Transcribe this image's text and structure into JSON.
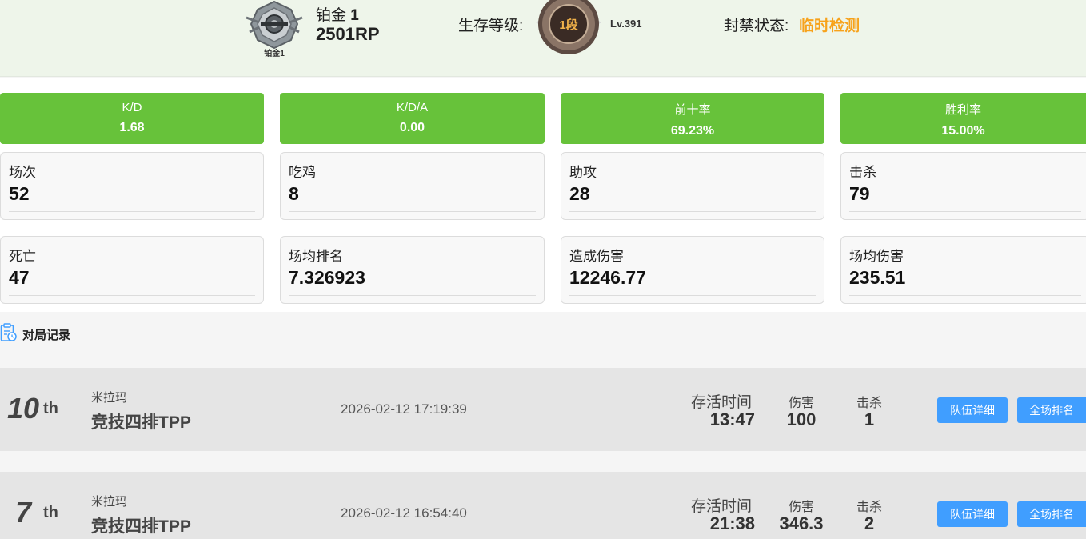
{
  "header": {
    "rank_emblem_label": "铂金1",
    "rank_tier": "铂金",
    "rank_division": "1",
    "rank_points": "2501RP",
    "survival_label": "生存等级:",
    "survival_badge": "1段",
    "survival_level": "Lv.391",
    "ban_label": "封禁状态:",
    "ban_value": "临时检测"
  },
  "ratios": [
    {
      "label": "K/D",
      "value": "1.68"
    },
    {
      "label": "K/D/A",
      "value": "0.00"
    },
    {
      "label": "前十率",
      "value": "69.23%"
    },
    {
      "label": "胜利率",
      "value": "15.00%"
    }
  ],
  "stats": [
    {
      "label": "场次",
      "value": "52"
    },
    {
      "label": "吃鸡",
      "value": "8"
    },
    {
      "label": "助攻",
      "value": "28"
    },
    {
      "label": "击杀",
      "value": "79"
    },
    {
      "label": "死亡",
      "value": "47"
    },
    {
      "label": "场均排名",
      "value": "7.326923"
    },
    {
      "label": "造成伤害",
      "value": "12246.77"
    },
    {
      "label": "场均伤害",
      "value": "235.51"
    }
  ],
  "records": {
    "title": "对局记录",
    "labels": {
      "survival_time": "存活时间",
      "damage": "伤害",
      "kills": "击杀",
      "team_detail_button": "队伍详细",
      "full_rank_button": "全场排名"
    },
    "matches": [
      {
        "place": "10",
        "suffix": "th",
        "map": "米拉玛",
        "mode": "竞技四排TPP",
        "datetime": "2026-02-12 17:19:39",
        "survival_time": "13:47",
        "damage": "100",
        "kills": "1"
      },
      {
        "place": "7",
        "suffix": "th",
        "map": "米拉玛",
        "mode": "竞技四排TPP",
        "datetime": "2026-02-12 16:54:40",
        "survival_time": "21:38",
        "damage": "346.3",
        "kills": "2"
      }
    ]
  },
  "colors": {
    "accent_green": "#67c23a",
    "button_blue": "#409eff",
    "warning_orange": "#f7a21b",
    "header_bg": "#eef5ea",
    "row_bg": "#e5e5e5"
  },
  "icons": {
    "rank_emblem": "platinum-rank-emblem-icon",
    "survival_badge": "survival-level-badge-icon",
    "records": "clipboard-clock-icon"
  }
}
